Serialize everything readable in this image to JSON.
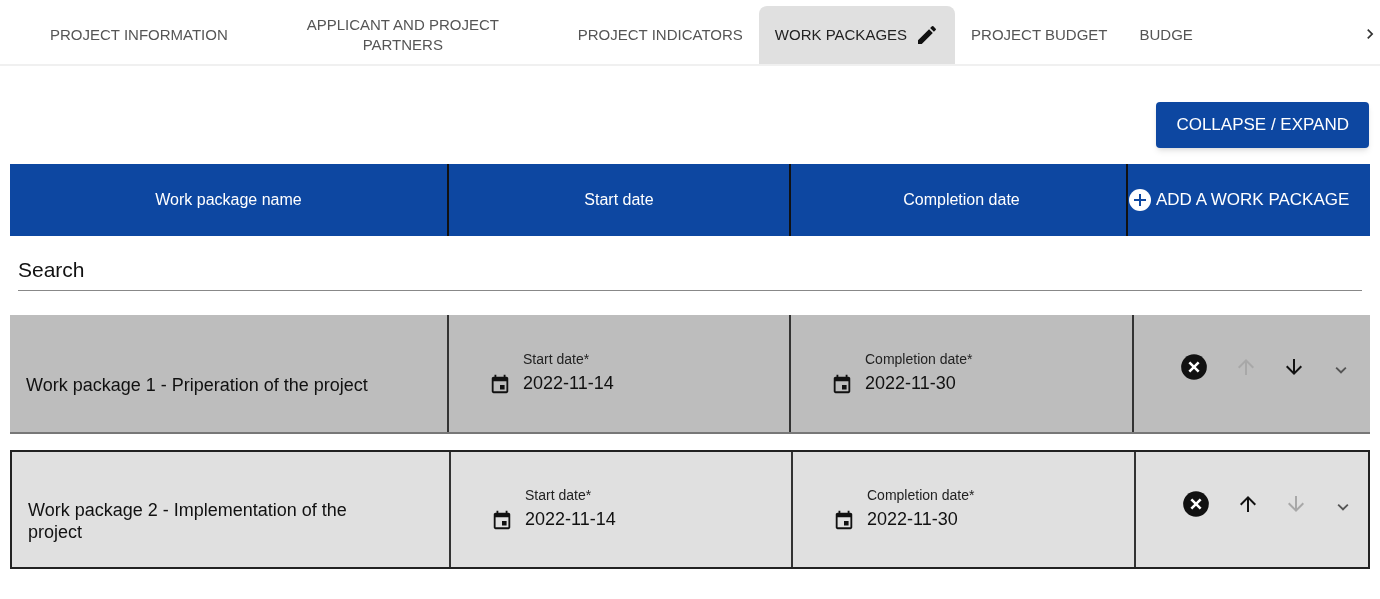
{
  "tabs": [
    {
      "label": "PROJECT INFORMATION",
      "selected": false,
      "edited": false
    },
    {
      "label": "APPLICANT AND PROJECT PARTNERS",
      "selected": false,
      "edited": false
    },
    {
      "label": "PROJECT INDICATORS",
      "selected": false,
      "edited": false
    },
    {
      "label": "WORK PACKAGES",
      "selected": true,
      "edited": true
    },
    {
      "label": "PROJECT BUDGET",
      "selected": false,
      "edited": false
    },
    {
      "label": "BUDGE",
      "selected": false,
      "edited": false
    }
  ],
  "collapse_button": "COLLAPSE / EXPAND",
  "table": {
    "columns": [
      "Work package name",
      "Start date",
      "Completion date"
    ],
    "add_button": "ADD A WORK PACKAGE",
    "search": {
      "placeholder": "Search"
    },
    "rows": [
      {
        "name": "Work package 1 - Priperation of the project",
        "start_label": "Start date*",
        "start": "2022-11-14",
        "end_label": "Completion date*",
        "end": "2022-11-30",
        "selected": true,
        "up_disabled": true,
        "down_disabled": false
      },
      {
        "name": "Work package 2 - Implementation of the project",
        "start_label": "Start date*",
        "start": "2022-11-14",
        "end_label": "Completion date*",
        "end": "2022-11-30",
        "selected": false,
        "up_disabled": false,
        "down_disabled": true
      }
    ]
  }
}
